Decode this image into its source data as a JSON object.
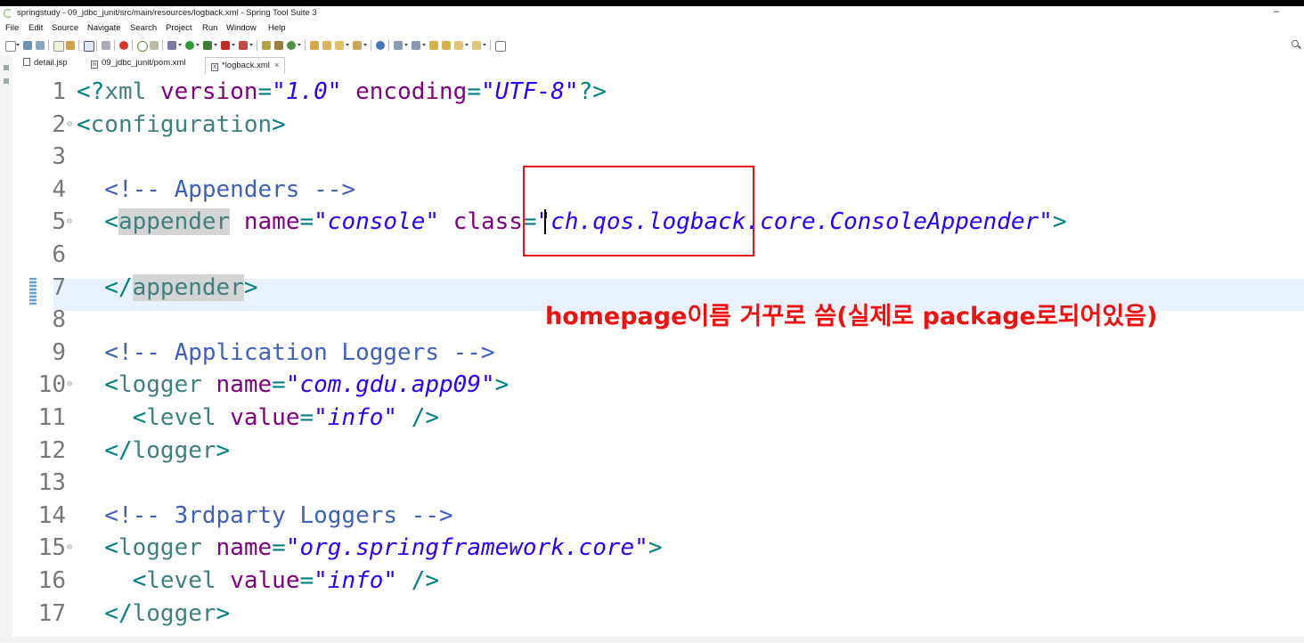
{
  "window": {
    "title": "springstudy - 09_jdbc_junit/src/main/resources/logback.xml - Spring Tool Suite 3",
    "minimize_glyph": "–"
  },
  "menu": [
    "File",
    "Edit",
    "Source",
    "Navigate",
    "Search",
    "Project",
    "Run",
    "Window",
    "Help"
  ],
  "tabs": [
    {
      "label": "detail.jsp",
      "icon": "jsp-file-icon",
      "active": false
    },
    {
      "label": "09_jdbc_junit/pom.xml",
      "icon": "maven-pom-icon",
      "active": false
    },
    {
      "label": "*logback.xml",
      "icon": "xml-file-icon",
      "active": true,
      "close": "×"
    }
  ],
  "editor": {
    "lines": [
      {
        "num": "1",
        "fold": "",
        "tokens": [
          [
            "p",
            "<?"
          ],
          [
            "t",
            "xml "
          ],
          [
            "a",
            "version"
          ],
          [
            "p",
            "="
          ],
          [
            "v",
            "\"1.0\""
          ],
          [
            "p",
            " "
          ],
          [
            "a",
            "encoding"
          ],
          [
            "p",
            "="
          ],
          [
            "v",
            "\"UTF-8\""
          ],
          [
            "p",
            "?>"
          ]
        ]
      },
      {
        "num": "2",
        "fold": "⊖",
        "tokens": [
          [
            "p",
            "<"
          ],
          [
            "t",
            "configuration"
          ],
          [
            "p",
            ">"
          ]
        ]
      },
      {
        "num": "3",
        "fold": "",
        "tokens": []
      },
      {
        "num": "4",
        "fold": "",
        "tokens": [
          [
            "c",
            "  <!-- Appenders -->"
          ]
        ]
      },
      {
        "num": "5",
        "fold": "⊖",
        "tokens": [
          [
            "p",
            "  <"
          ],
          [
            "tm",
            "appender"
          ],
          [
            "p",
            " "
          ],
          [
            "a",
            "name"
          ],
          [
            "p",
            "="
          ],
          [
            "v",
            "\"console\""
          ],
          [
            "p",
            " "
          ],
          [
            "a",
            "class"
          ],
          [
            "p",
            "="
          ],
          [
            "v",
            "\"ch.qos.logback.core.ConsoleAppender\""
          ],
          [
            "p",
            ">"
          ]
        ]
      },
      {
        "num": "6",
        "fold": "",
        "tokens": []
      },
      {
        "num": "7",
        "fold": "",
        "tokens": [
          [
            "p",
            "  </"
          ],
          [
            "tm",
            "appender"
          ],
          [
            "p",
            ">"
          ]
        ]
      },
      {
        "num": "8",
        "fold": "",
        "tokens": []
      },
      {
        "num": "9",
        "fold": "",
        "tokens": [
          [
            "c",
            "  <!-- Application Loggers -->"
          ]
        ]
      },
      {
        "num": "10",
        "fold": "⊖",
        "tokens": [
          [
            "p",
            "  <"
          ],
          [
            "t",
            "logger"
          ],
          [
            "p",
            " "
          ],
          [
            "a",
            "name"
          ],
          [
            "p",
            "="
          ],
          [
            "v",
            "\"com.gdu.app09\""
          ],
          [
            "p",
            ">"
          ]
        ]
      },
      {
        "num": "11",
        "fold": "",
        "tokens": [
          [
            "p",
            "    <"
          ],
          [
            "t",
            "level"
          ],
          [
            "p",
            " "
          ],
          [
            "a",
            "value"
          ],
          [
            "p",
            "="
          ],
          [
            "v",
            "\"info\""
          ],
          [
            "p",
            " />"
          ]
        ]
      },
      {
        "num": "12",
        "fold": "",
        "tokens": [
          [
            "p",
            "  </"
          ],
          [
            "t",
            "logger"
          ],
          [
            "p",
            ">"
          ]
        ]
      },
      {
        "num": "13",
        "fold": "",
        "tokens": []
      },
      {
        "num": "14",
        "fold": "",
        "tokens": [
          [
            "c",
            "  <!-- 3rdparty Loggers -->"
          ]
        ]
      },
      {
        "num": "15",
        "fold": "⊖",
        "tokens": [
          [
            "p",
            "  <"
          ],
          [
            "t",
            "logger"
          ],
          [
            "p",
            " "
          ],
          [
            "a",
            "name"
          ],
          [
            "p",
            "="
          ],
          [
            "v",
            "\"org.springframework.core\""
          ],
          [
            "p",
            ">"
          ]
        ]
      },
      {
        "num": "16",
        "fold": "",
        "tokens": [
          [
            "p",
            "    <"
          ],
          [
            "t",
            "level"
          ],
          [
            "p",
            " "
          ],
          [
            "a",
            "value"
          ],
          [
            "p",
            "="
          ],
          [
            "v",
            "\"info\""
          ],
          [
            "p",
            " />"
          ]
        ]
      },
      {
        "num": "17",
        "fold": "",
        "tokens": [
          [
            "p",
            "  </"
          ],
          [
            "t",
            "logger"
          ],
          [
            "p",
            ">"
          ]
        ]
      }
    ]
  },
  "annotation": {
    "text": "homepage이름 거꾸로 씀(실제로 package로되어있음)",
    "color": "#ee1111"
  },
  "colors": {
    "tag": "#3f7f7f",
    "attribute": "#7f007f",
    "value": "#2a00ff",
    "comment": "#3f5fbf",
    "current_line": "#e8f2fe",
    "highlight_box": "#e8141a"
  }
}
